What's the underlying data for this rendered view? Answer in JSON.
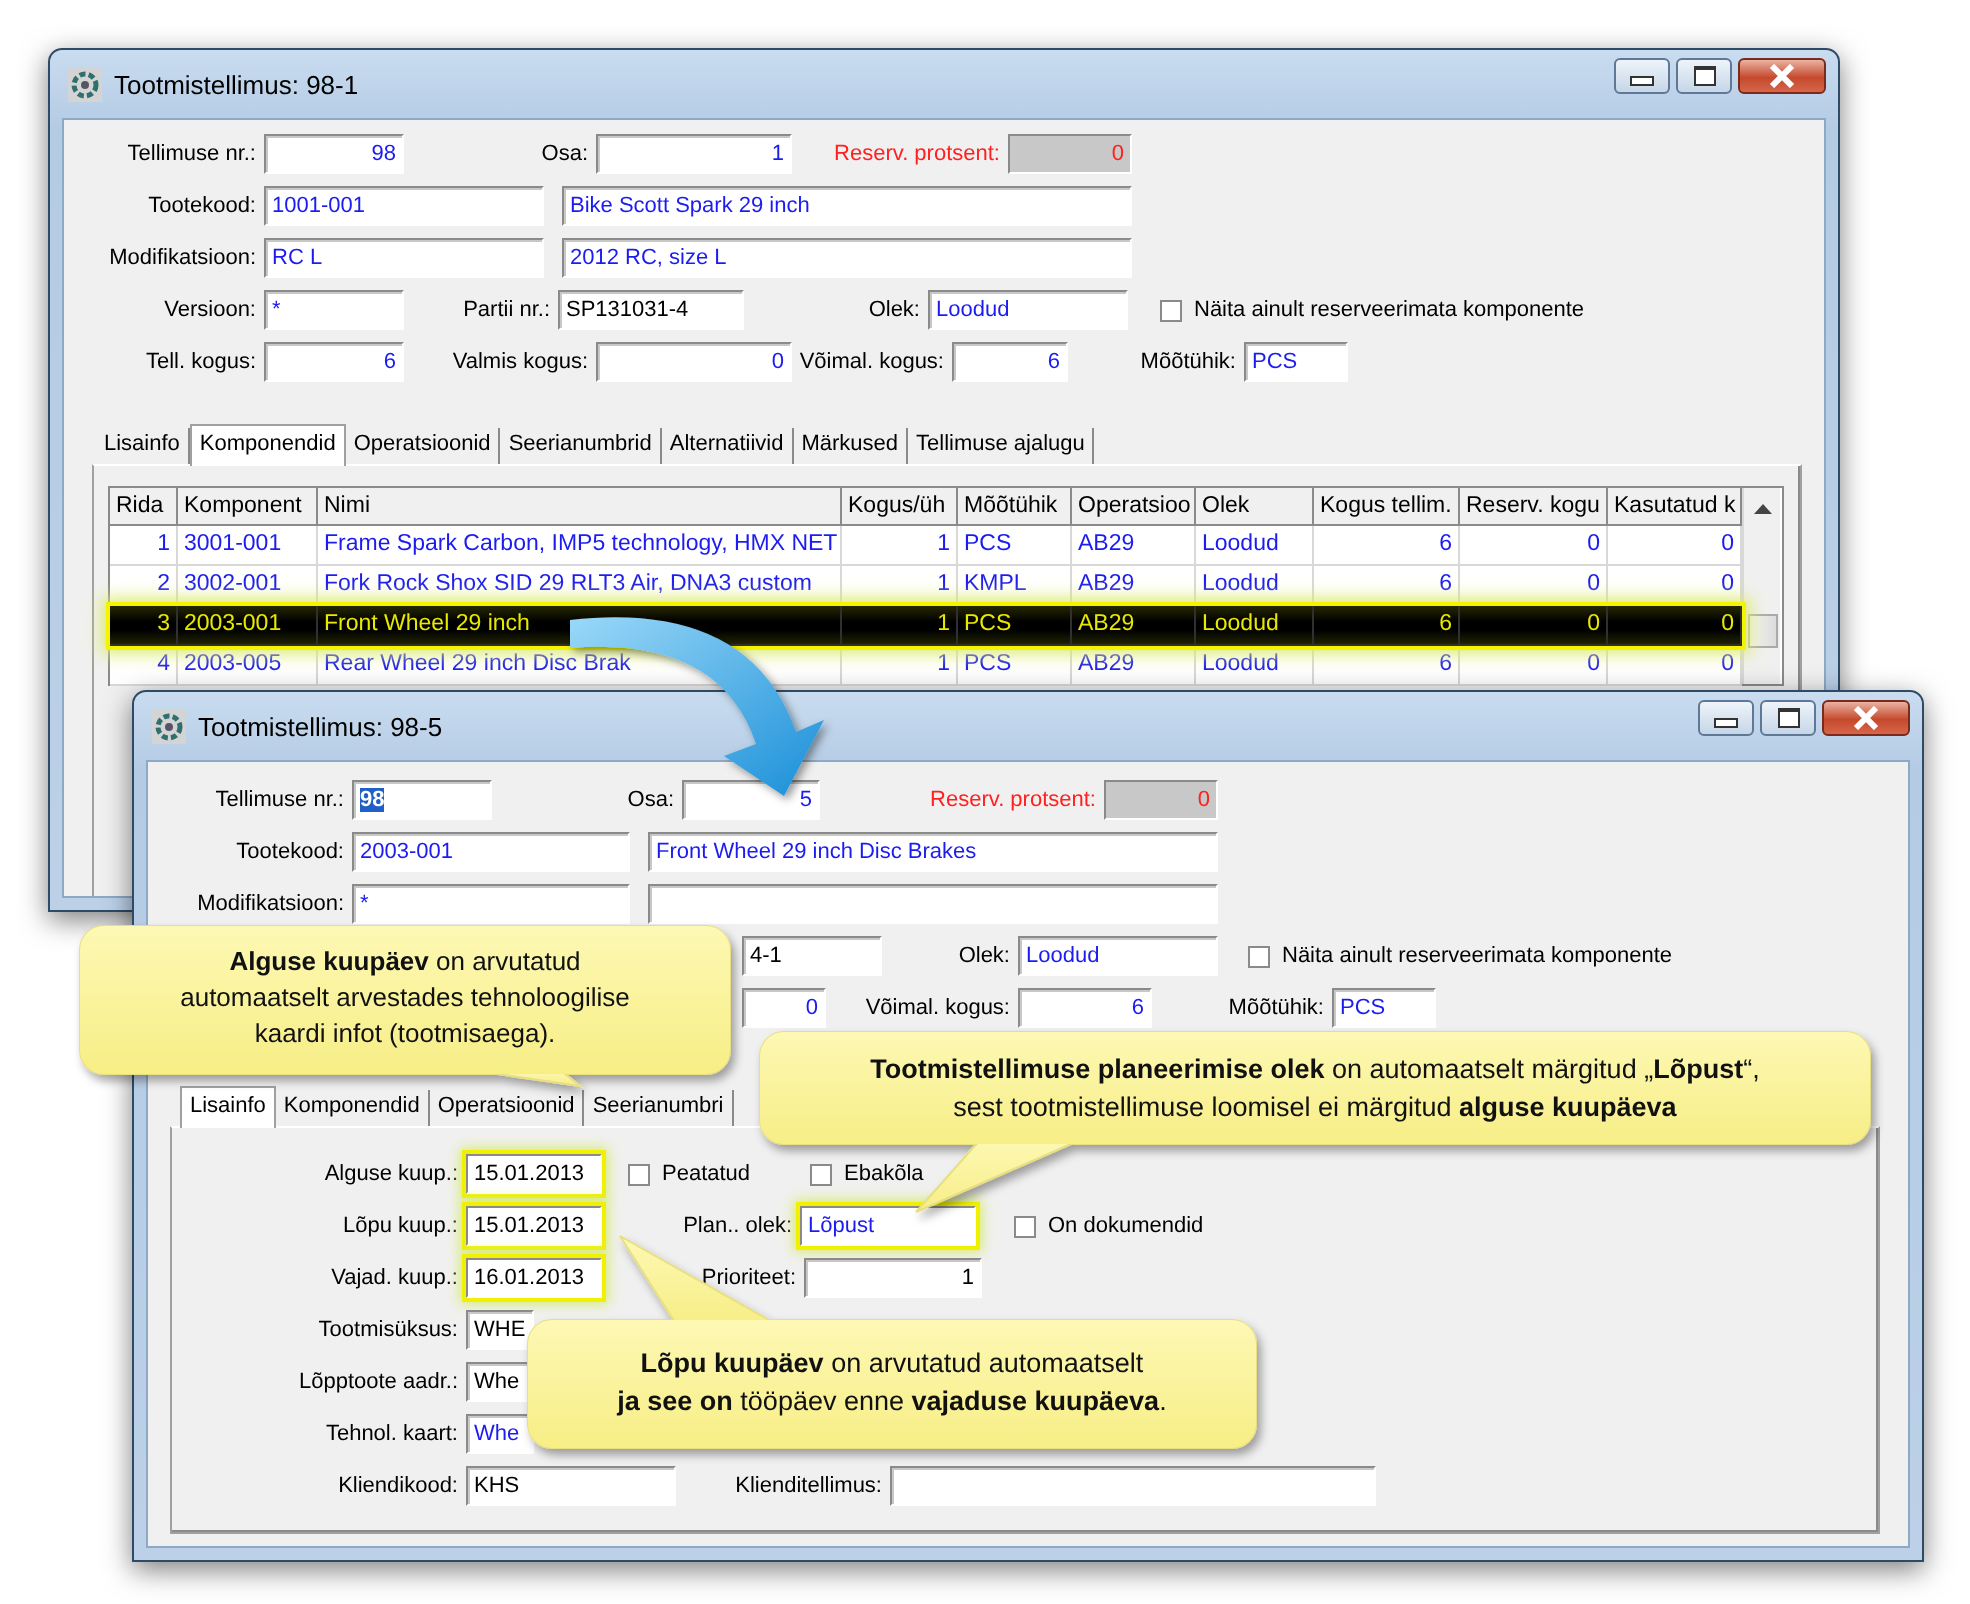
{
  "main_window": {
    "title": "Tootmistellimus: 98-1",
    "form": {
      "tellimuse_nr": {
        "label": "Tellimuse nr.:",
        "value": "98"
      },
      "osa": {
        "label": "Osa:",
        "value": "1"
      },
      "reserv_protsent": {
        "label": "Reserv. protsent:",
        "value": "0"
      },
      "tootekood": {
        "label": "Tootekood:",
        "code": "1001-001",
        "name": "Bike Scott Spark 29 inch"
      },
      "modifikatsioon": {
        "label": "Modifikatsioon:",
        "code": "RC L",
        "name": "2012 RC, size L"
      },
      "versioon": {
        "label": "Versioon:",
        "value": "*"
      },
      "partii_nr": {
        "label": "Partii nr.:",
        "value": "SP131031-4"
      },
      "olek": {
        "label": "Olek:",
        "value": "Loodud"
      },
      "reserved_only": {
        "label": "Näita ainult reserveerimata komponente",
        "checked": false
      },
      "tell_kogus": {
        "label": "Tell. kogus:",
        "value": "6"
      },
      "valmis_kogus": {
        "label": "Valmis kogus:",
        "value": "0"
      },
      "voimal_kogus": {
        "label": "Võimal. kogus:",
        "value": "6"
      },
      "mootuhik": {
        "label": "Mõõtühik:",
        "value": "PCS"
      }
    },
    "tabs": [
      {
        "label": "Lisainfo",
        "selected": false
      },
      {
        "label": "Komponendid",
        "selected": true
      },
      {
        "label": "Operatsioonid",
        "selected": false
      },
      {
        "label": "Seerianumbrid",
        "selected": false
      },
      {
        "label": "Alternatiivid",
        "selected": false
      },
      {
        "label": "Märkused",
        "selected": false
      },
      {
        "label": "Tellimuse ajalugu",
        "selected": false
      }
    ],
    "table": {
      "columns": [
        "Rida",
        "Komponent",
        "Nimi",
        "Kogus/üh",
        "Mõõtühik",
        "Operatsioo",
        "Olek",
        "Kogus tellim.",
        "Reserv. kogu",
        "Kasutatud k"
      ],
      "rows": [
        {
          "cells": [
            "1",
            "3001-001",
            "Frame Spark Carbon, IMP5 technology, HMX NET",
            "1",
            "PCS",
            "AB29",
            "Loodud",
            "6",
            "0",
            "0"
          ],
          "selected": false
        },
        {
          "cells": [
            "2",
            "3002-001",
            "Fork Rock Shox SID 29 RLT3 Air, DNA3 custom",
            "1",
            "KMPL",
            "AB29",
            "Loodud",
            "6",
            "0",
            "0"
          ],
          "selected": false
        },
        {
          "cells": [
            "3",
            "2003-001",
            "Front Wheel 29 inch",
            "1",
            "PCS",
            "AB29",
            "Loodud",
            "6",
            "0",
            "0"
          ],
          "selected": true
        },
        {
          "cells": [
            "4",
            "2003-005",
            "Rear Wheel 29 inch Disc Brak",
            "1",
            "PCS",
            "AB29",
            "Loodud",
            "6",
            "0",
            "0"
          ],
          "selected": false
        }
      ]
    }
  },
  "detail_window": {
    "title": "Tootmistellimus: 98-5",
    "form": {
      "tellimuse_nr": {
        "label": "Tellimuse nr.:",
        "value": "98",
        "value_selected": true
      },
      "osa": {
        "label": "Osa:",
        "value": "5"
      },
      "reserv_protsent": {
        "label": "Reserv. protsent:",
        "value": "0"
      },
      "tootekood": {
        "label": "Tootekood:",
        "code": "2003-001",
        "name": "Front Wheel 29 inch Disc Brakes"
      },
      "modifikatsioon": {
        "label": "Modifikatsioon:",
        "code": "*"
      },
      "partii_nr": {
        "value": "4-1"
      },
      "olek": {
        "label": "Olek:",
        "value": "Loodud"
      },
      "reserved_only": {
        "label": "Näita ainult reserveerimata komponente",
        "checked": false
      },
      "valmis_kogus": {
        "value": "0"
      },
      "voimal_kogus": {
        "label": "Võimal. kogus:",
        "value": "6"
      },
      "mootuhik": {
        "label": "Mõõtühik:",
        "value": "PCS"
      }
    },
    "tabs": [
      {
        "label": "Lisainfo",
        "selected": true
      },
      {
        "label": "Komponendid",
        "selected": false
      },
      {
        "label": "Operatsioonid",
        "selected": false
      },
      {
        "label": "Seerianumbri",
        "selected": false
      }
    ],
    "panel": {
      "alguse_kuup": {
        "label": "Alguse kuup.:",
        "value": "15.01.2013",
        "highlighted": true
      },
      "peatatud": {
        "label": "Peatatud",
        "checked": false
      },
      "ebakola": {
        "label": "Ebakõla",
        "checked": false
      },
      "lopu_kuup": {
        "label": "Lõpu kuup.:",
        "value": "15.01.2013",
        "highlighted": true
      },
      "plan_olek": {
        "label": "Plan.. olek:",
        "value": "Lõpust",
        "highlighted": true
      },
      "on_dokumendid": {
        "label": "On dokumendid",
        "checked": false
      },
      "vajad_kuup": {
        "label": "Vajad. kuup.:",
        "value": "16.01.2013",
        "highlighted": true
      },
      "prioriteet": {
        "label": "Prioriteet:",
        "value": "1"
      },
      "tootmisuksus": {
        "label": "Tootmisüksus:",
        "value": "WHE"
      },
      "lopptoote_aadr": {
        "label": "Lõpptoote aadr.:",
        "value": "Whe"
      },
      "tehnol_kaart": {
        "label": "Tehnol. kaart:",
        "value": "Whe"
      },
      "kliendikood": {
        "label": "Kliendikood:",
        "value": "KHS"
      },
      "klienditellimus": {
        "label": "Klienditellimus:"
      }
    }
  },
  "callouts": [
    {
      "lines": [
        "**Alguse kuupäev** on arvutatud",
        "automaatselt arvestades  tehnoloogilise",
        "kaardi infot (tootmisaega)."
      ]
    },
    {
      "lines": [
        "**Tootmistellimuse planeerimise olek** on automaatselt märgitud „**Lõpust**“,",
        "sest tootmistellimuse loomisel ei märgitud **alguse kuupäeva**"
      ]
    },
    {
      "lines": [
        "**Lõpu kuupäev** on arvutatud automaatselt",
        "**ja see on** tööpäev enne **vajaduse kuupäeva**."
      ]
    }
  ]
}
